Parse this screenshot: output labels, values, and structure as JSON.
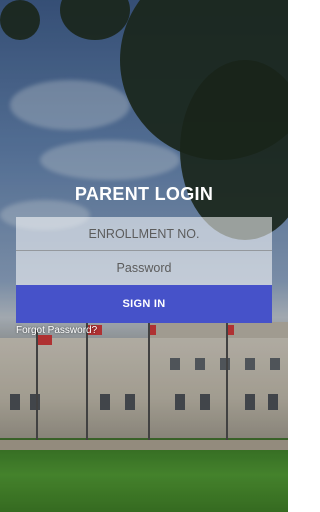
{
  "login": {
    "title": "PARENT LOGIN",
    "enrollment_placeholder": "ENROLLMENT NO.",
    "password_placeholder": "Password",
    "signin_label": "SIGN IN",
    "forgot_label": "Forgot Password?"
  },
  "colors": {
    "signin_button": "#4652c9",
    "title_text": "#ffffff"
  }
}
